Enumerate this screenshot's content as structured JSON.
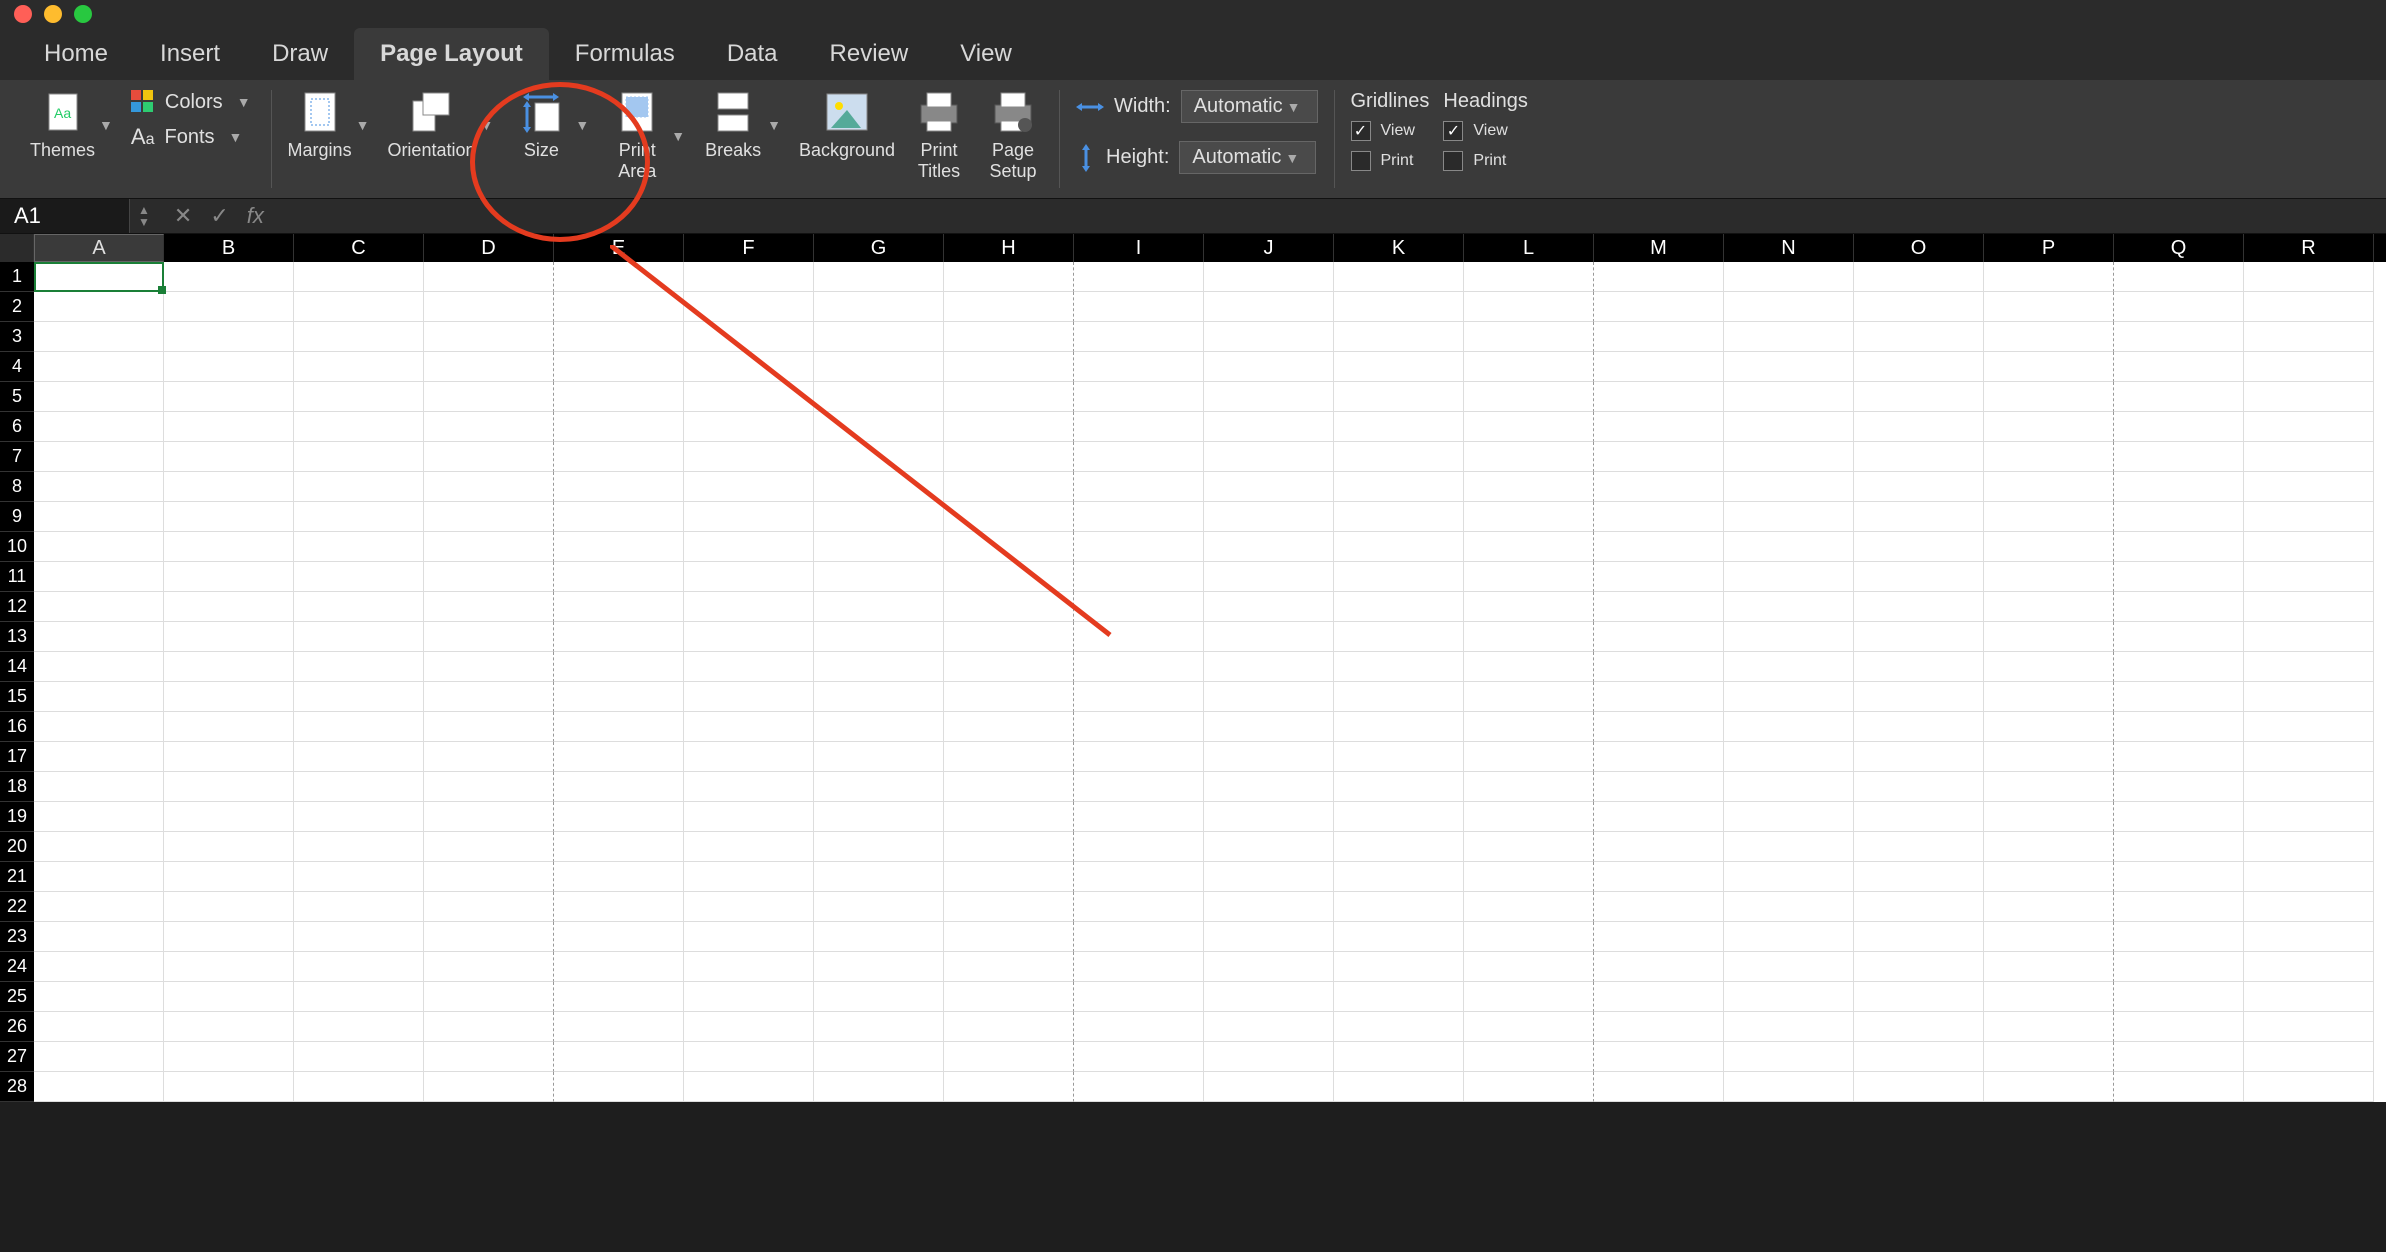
{
  "tabs": [
    "Home",
    "Insert",
    "Draw",
    "Page Layout",
    "Formulas",
    "Data",
    "Review",
    "View"
  ],
  "active_tab": "Page Layout",
  "ribbon": {
    "themes": {
      "label": "Themes"
    },
    "colors": {
      "label": "Colors"
    },
    "fonts": {
      "label": "Fonts"
    },
    "margins": {
      "label": "Margins"
    },
    "orientation": {
      "label": "Orientation"
    },
    "size": {
      "label": "Size"
    },
    "print_area": {
      "label": "Print\nArea"
    },
    "breaks": {
      "label": "Breaks"
    },
    "background": {
      "label": "Background"
    },
    "print_titles": {
      "label": "Print\nTitles"
    },
    "page_setup": {
      "label": "Page\nSetup"
    },
    "width": {
      "label": "Width:",
      "value": "Automatic"
    },
    "height": {
      "label": "Height:",
      "value": "Automatic"
    },
    "gridlines": {
      "label": "Gridlines",
      "view": {
        "label": "View",
        "checked": true
      },
      "print": {
        "label": "Print",
        "checked": false
      }
    },
    "headings": {
      "label": "Headings",
      "view": {
        "label": "View",
        "checked": true
      },
      "print": {
        "label": "Print",
        "checked": false
      }
    }
  },
  "namebox": "A1",
  "fx": "",
  "columns": [
    "A",
    "B",
    "C",
    "D",
    "E",
    "F",
    "G",
    "H",
    "I",
    "J",
    "K",
    "L",
    "M",
    "N",
    "O",
    "P",
    "Q",
    "R"
  ],
  "rows": 28,
  "selected_cell": {
    "row": 1,
    "col": "A"
  },
  "page_break_cols": [
    "D",
    "H",
    "L",
    "P"
  ]
}
